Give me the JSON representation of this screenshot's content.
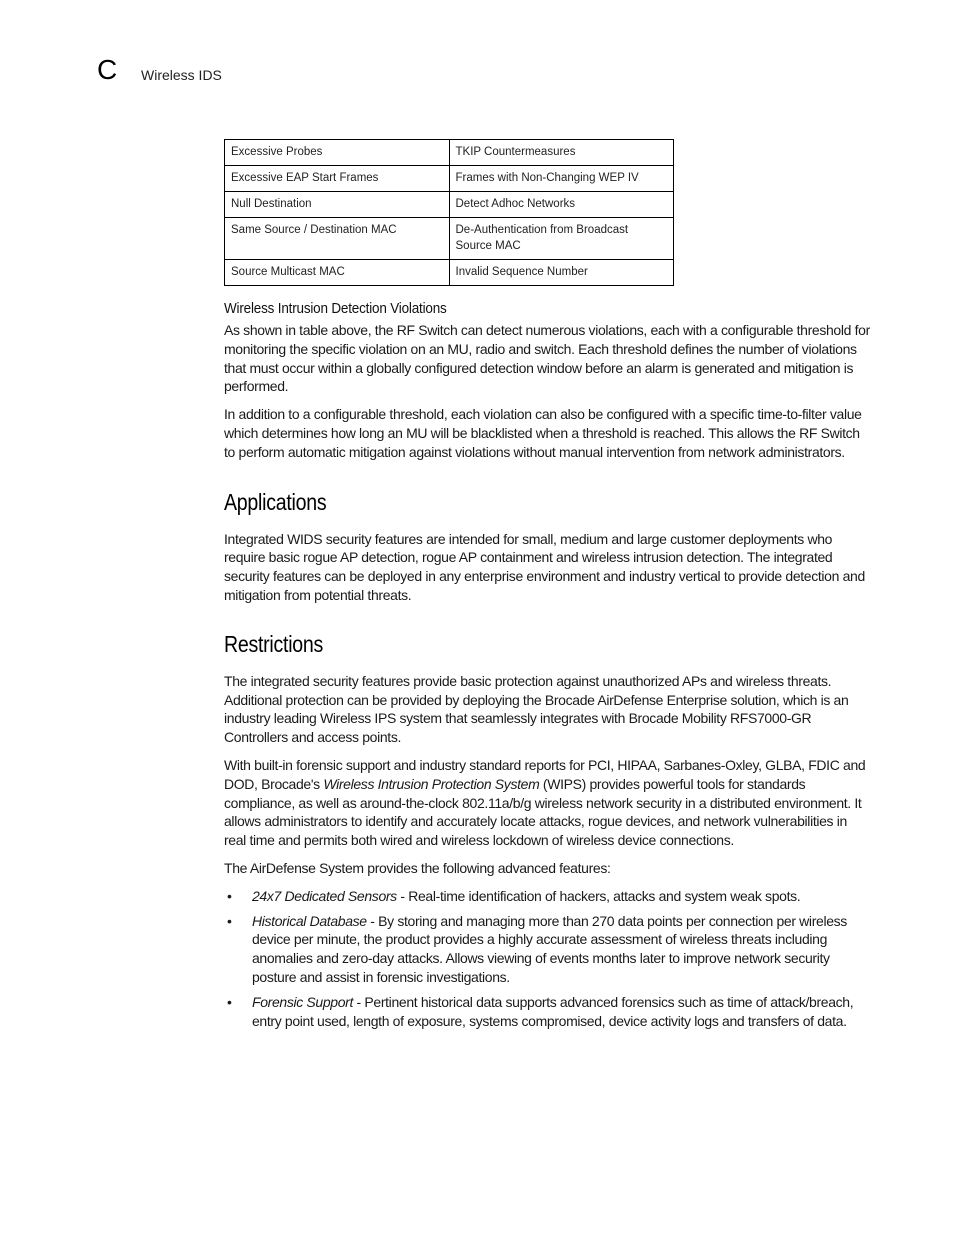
{
  "header": {
    "chapter_letter": "C",
    "section_title": "Wireless IDS"
  },
  "violations_table": {
    "rows": [
      [
        "Excessive Probes",
        "TKIP Countermeasures"
      ],
      [
        "Excessive EAP Start Frames",
        "Frames with Non-Changing WEP IV"
      ],
      [
        "Null Destination",
        "Detect Adhoc Networks"
      ],
      [
        "Same Source / Destination MAC",
        "De-Authentication from Broadcast Source MAC"
      ],
      [
        "Source Multicast MAC",
        "Invalid Sequence Number"
      ]
    ]
  },
  "violations_section": {
    "heading": "Wireless Intrusion Detection Violations",
    "paragraphs": [
      "As shown in table above, the RF Switch can detect numerous violations, each with a configurable threshold for monitoring the specific violation on an MU, radio and switch. Each threshold defines the number of violations that must occur within a globally configured detection window before an alarm is generated and mitigation is performed.",
      "In addition to a configurable threshold, each violation can also be configured with a specific time-to-filter value which determines how long an MU will be blacklisted when a threshold is reached. This allows the RF Switch to perform automatic mitigation against violations without manual intervention from network administrators."
    ]
  },
  "applications_section": {
    "heading": "Applications",
    "paragraphs": [
      "Integrated WIDS security features are intended for small, medium and large customer deployments who require basic rogue AP detection, rogue AP containment and wireless intrusion detection. The integrated security features can be deployed in any enterprise environment and industry vertical to provide detection and mitigation from potential threats."
    ]
  },
  "restrictions_section": {
    "heading": "Restrictions",
    "paragraph1": "The integrated security features provide basic protection against unauthorized APs and wireless threats. Additional protection can be provided by deploying the Brocade AirDefense Enterprise solution, which is an industry leading Wireless IPS system that seamlessly integrates with Brocade Mobility RFS7000-GR Controllers and access points.",
    "paragraph2": {
      "before": "With built-in forensic support and industry standard reports for PCI, HIPAA, Sarbanes-Oxley, GLBA, FDIC and DOD, Brocade's ",
      "italic": "Wireless Intrusion Protection System",
      "after": " (WIPS) provides powerful tools for standards compliance, as well as around-the-clock 802.11a/b/g wireless network security in a distributed environment. It allows administrators to identify and accurately locate attacks, rogue devices, and network vulnerabilities in real time and permits both wired and wireless lockdown of wireless device connections."
    },
    "features_intro": "The AirDefense System provides the following advanced features:",
    "features": [
      {
        "title": "24x7 Dedicated Sensors",
        "text": " - Real-time identification of hackers, attacks and system weak spots."
      },
      {
        "title": "Historical Database",
        "text": " - By storing and managing more than 270 data points per connection per wireless device per minute, the product provides a highly accurate assessment of wireless threats including anomalies and zero-day attacks. Allows viewing of events months later to improve network security posture and assist in forensic investigations."
      },
      {
        "title": "Forensic Support",
        "text": " - Pertinent historical data supports advanced forensics such as time of attack/breach, entry point used, length of exposure, systems compromised, device activity logs and transfers of data."
      }
    ],
    "bullet_glyph": "•"
  }
}
